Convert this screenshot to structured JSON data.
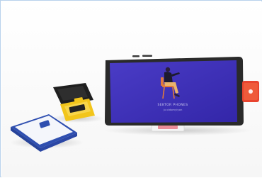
{
  "photo": {
    "description_free": true,
    "colors": {
      "background": "#ffffff",
      "frame_border": "#b9d2ec",
      "phone_screen": "#3d2fb6",
      "phone_body": "#2b2b2b",
      "yellow_device": "#f2c51b",
      "blue_device": "#2f4fb0",
      "red_device": "#e8442f"
    }
  },
  "screen": {
    "title": "SEKTOR PHONES",
    "subtitle": "ju oldomyiyon"
  }
}
